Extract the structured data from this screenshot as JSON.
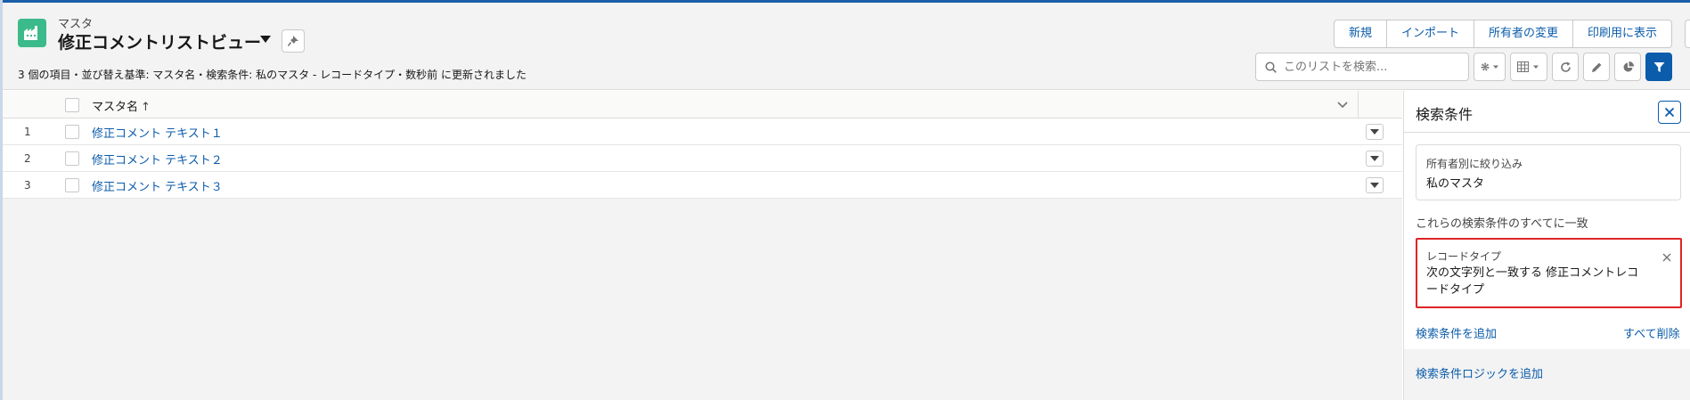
{
  "header": {
    "object_label": "マスタ",
    "view_title": "修正コメントリストビュー",
    "subtitle": "3 個の項目・並び替え基準: マスタ名・検索条件: 私のマスタ - レコードタイプ・数秒前 に更新されました",
    "actions": [
      "新規",
      "インポート",
      "所有者の変更",
      "印刷用に表示"
    ]
  },
  "search": {
    "placeholder": "このリストを検索..."
  },
  "toolbar": {
    "settings_icon": "gear-icon",
    "display_icon": "table-icon",
    "refresh_icon": "refresh-icon",
    "edit_icon": "pencil-icon",
    "chart_icon": "pie-chart-icon",
    "filter_icon": "filter-icon"
  },
  "table": {
    "column": "マスタ名",
    "sort_indicator": "↑",
    "rows": [
      {
        "num": "1",
        "name": "修正コメント テキスト１"
      },
      {
        "num": "2",
        "name": "修正コメント テキスト２"
      },
      {
        "num": "3",
        "name": "修正コメント テキスト３"
      }
    ]
  },
  "filter_panel": {
    "title": "検索条件",
    "owner_label": "所有者別に絞り込み",
    "owner_value": "私のマスタ",
    "match_text": "これらの検索条件のすべてに一致",
    "filter_label": "レコードタイプ",
    "filter_value": "次の文字列と一致する 修正コメントレコードタイプ",
    "add_filter": "検索条件を追加",
    "remove_all": "すべて削除",
    "add_logic": "検索条件ロジックを追加"
  },
  "colors": {
    "accent": "#0b5cab",
    "app_icon": "#3bba8b",
    "highlight": "#e02424"
  }
}
